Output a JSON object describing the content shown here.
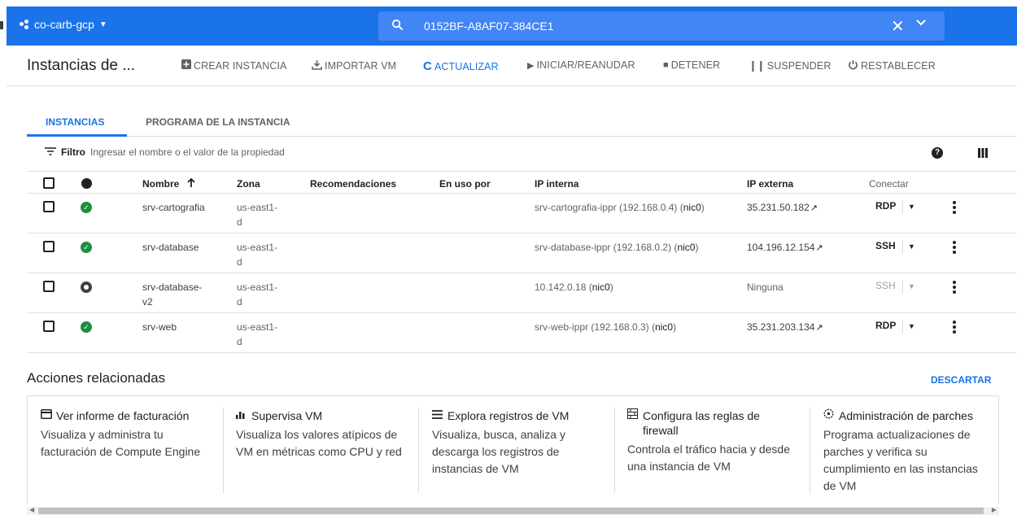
{
  "topbar": {
    "project_name": "co-carb-gcp",
    "search_value": "0152BF-A8AF07-384CE1",
    "clear_icon": "close-icon",
    "expand_icon": "chevron-down-icon",
    "brand_color": "#1a73e8"
  },
  "header": {
    "title": "Instancias de ...",
    "toolbar": {
      "create": "CREAR INSTANCIA",
      "import": "IMPORTAR VM",
      "refresh": "ACTUALIZAR",
      "start": "INICIAR/REANUDAR",
      "stop": "DETENER",
      "suspend": "SUSPENDER",
      "reset": "RESTABLECER"
    }
  },
  "tabs": [
    "INSTANCIAS",
    "PROGRAMA DE LA INSTANCIA"
  ],
  "filter": {
    "label": "Filtro",
    "placeholder": "Ingresar el nombre o el valor de la propiedad"
  },
  "table": {
    "headers": {
      "name": "Nombre",
      "zone": "Zona",
      "recommendations": "Recomendaciones",
      "in_use_by": "En uso por",
      "internal_ip": "IP interna",
      "external_ip": "IP externa",
      "connect": "Conectar"
    },
    "rows": [
      {
        "status": "running",
        "name": "srv-cartografia",
        "zone": [
          "us-east1-",
          "d"
        ],
        "internal_ip": "srv-cartografia-ippr (192.168.0.4) (",
        "nic": "nic0",
        "internal_ip_end": ")",
        "external_ip": "35.231.50.182",
        "connect": "RDP"
      },
      {
        "status": "running",
        "name": "srv-database",
        "zone": [
          "us-east1-",
          "d"
        ],
        "internal_ip": "srv-database-ippr (192.168.0.2) (",
        "nic": "nic0",
        "internal_ip_end": ")",
        "external_ip": "104.196.12.154",
        "connect": "SSH"
      },
      {
        "status": "stopped",
        "name": [
          "srv-database-",
          "v2"
        ],
        "zone": [
          "us-east1-",
          "d"
        ],
        "internal_ip": "10.142.0.18 (",
        "nic": "nic0",
        "internal_ip_end": ")",
        "external_ip": "Ninguna",
        "connect": "SSH"
      },
      {
        "status": "running",
        "name": "srv-web",
        "zone": [
          "us-east1-",
          "d"
        ],
        "internal_ip": "srv-web-ippr (192.168.0.3) (",
        "nic": "nic0",
        "internal_ip_end": ")",
        "external_ip": "35.231.203.134",
        "connect": "RDP"
      }
    ]
  },
  "related": {
    "title": "Acciones relacionadas",
    "dismiss": "DESCARTAR",
    "cards": [
      {
        "icon": "billing-card-icon",
        "title": "Ver informe de facturación",
        "description": "Visualiza y administra tu facturación de Compute Engine"
      },
      {
        "icon": "bar-chart-icon",
        "title": "Supervisa VM",
        "description": "Visualiza los valores atípicos de VM en métricas como CPU y red"
      },
      {
        "icon": "logs-list-icon",
        "title": "Explora registros de VM",
        "description": "Visualiza, busca, analiza y descarga los registros de instancias de VM"
      },
      {
        "icon": "firewall-icon",
        "title": "Configura las reglas de firewall",
        "description": "Controla el tráfico hacia y desde una instancia de VM"
      },
      {
        "icon": "patch-management-icon",
        "title": "Administración de parches",
        "description": "Programa actualizaciones de parches y verifica su cumplimiento en las instancias de VM"
      }
    ]
  }
}
